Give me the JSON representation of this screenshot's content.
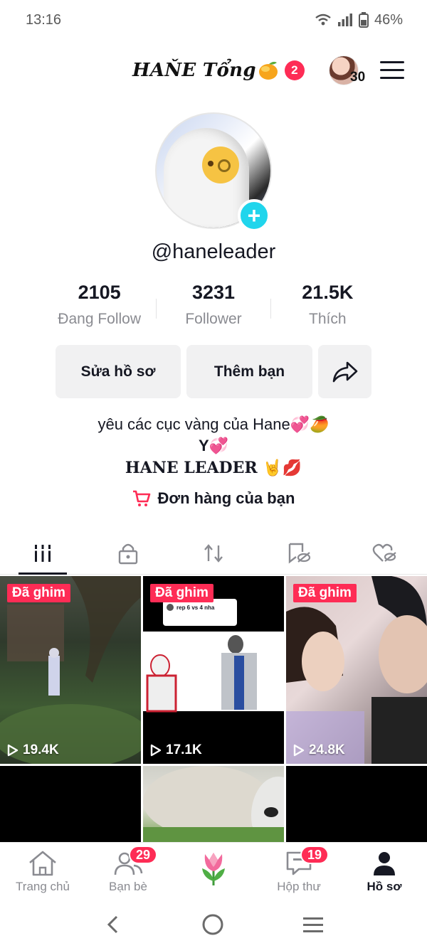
{
  "status_bar": {
    "time": "13:16",
    "battery": "46%"
  },
  "header": {
    "title": "HAŇE Tổng",
    "title_emoji_icon": "mango-icon",
    "notification_count": "2",
    "friends_count": "30"
  },
  "profile": {
    "username": "@haneleader",
    "stats": [
      {
        "value": "2105",
        "label": "Đang Follow"
      },
      {
        "value": "3231",
        "label": "Follower"
      },
      {
        "value": "21.5K",
        "label": "Thích"
      }
    ]
  },
  "buttons": {
    "edit": "Sửa hồ sơ",
    "add_friend": "Thêm bạn"
  },
  "bio": {
    "line1": "yêu các cục vàng của Hane💞🥭",
    "line2": "Y💞",
    "line3": "HANE LEADER 🤘💋"
  },
  "orders_label": "Đơn hàng của bạn",
  "tabs": [
    "videos-grid",
    "private-lock",
    "reposts",
    "saved",
    "liked"
  ],
  "videos": [
    {
      "pinned_label": "Đã ghim",
      "views": "19.4K",
      "overlay": ""
    },
    {
      "pinned_label": "Đã ghim",
      "views": "17.1K",
      "overlay": "rep 6 vs 4 nha"
    },
    {
      "pinned_label": "Đã ghim",
      "views": "24.8K",
      "overlay": ""
    }
  ],
  "bottom_nav": [
    {
      "label": "Trang chủ",
      "badge": ""
    },
    {
      "label": "Bạn bè",
      "badge": "29"
    },
    {
      "label": "",
      "badge": ""
    },
    {
      "label": "Hộp thư",
      "badge": "19"
    },
    {
      "label": "Hồ sơ",
      "badge": ""
    }
  ],
  "colors": {
    "accent": "#fe2c55",
    "cyan": "#20d5ec",
    "text": "#161823",
    "muted": "#8a8b91"
  }
}
